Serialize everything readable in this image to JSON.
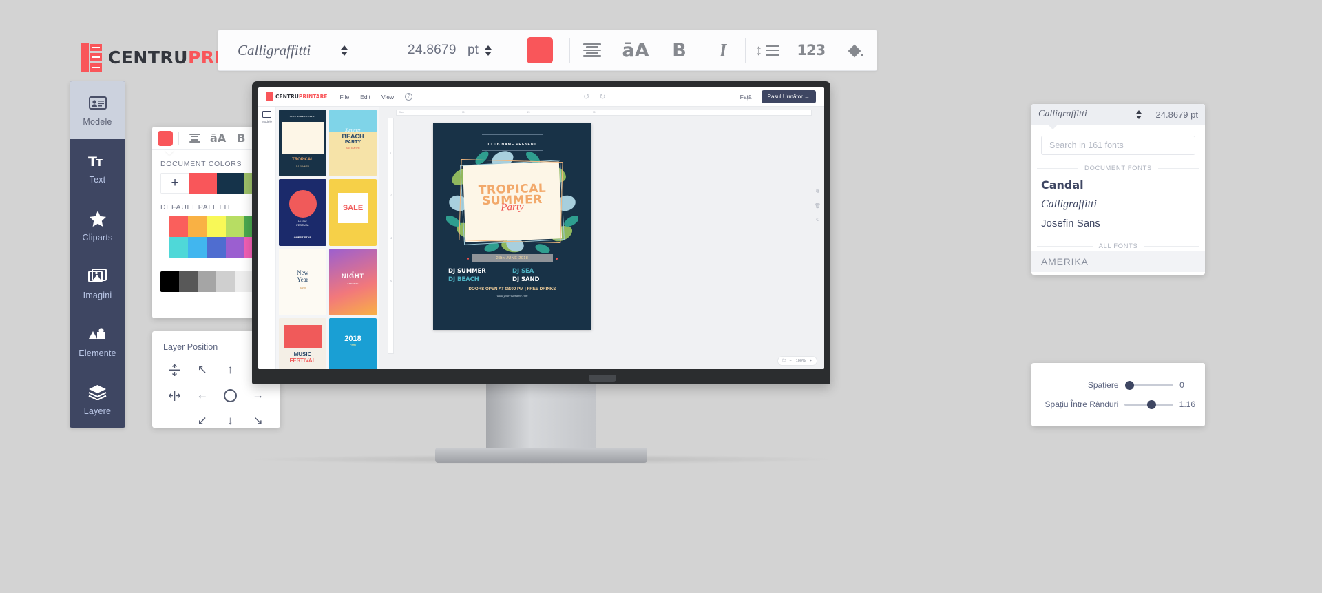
{
  "brand": {
    "name_part1": "CENTRU",
    "name_part2": "PRINTARE"
  },
  "toolbar": {
    "font_name": "Calligraffitti",
    "font_size": "24.8679",
    "font_size_unit": "pt",
    "color_swatch": "#f9565a",
    "icons": [
      {
        "name": "align-center-icon",
        "label": ""
      },
      {
        "name": "text-case-icon",
        "label": "āA"
      },
      {
        "name": "bold-icon",
        "label": "B"
      },
      {
        "name": "italic-icon",
        "label": "I"
      },
      {
        "name": "line-spacing-icon",
        "label": ""
      },
      {
        "name": "numbers-icon",
        "label": "123"
      },
      {
        "name": "fill-color-icon",
        "label": ""
      }
    ]
  },
  "sidebar": {
    "items": [
      {
        "label": "Modele",
        "icon": "id-card-icon",
        "active": true
      },
      {
        "label": "Text",
        "icon": "text-icon",
        "active": false
      },
      {
        "label": "Cliparts",
        "icon": "star-icon",
        "active": false
      },
      {
        "label": "Imagini",
        "icon": "image-icon",
        "active": false
      },
      {
        "label": "Elemente",
        "icon": "shapes-icon",
        "active": false
      },
      {
        "label": "Layere",
        "icon": "layers-icon",
        "active": false
      }
    ]
  },
  "color_panel": {
    "swatch": "#f9565a",
    "document_colors_title": "DOCUMENT COLORS",
    "add_label": "+",
    "document_colors": [
      "#f9565a",
      "#15334a",
      "#9dc069"
    ],
    "default_palette_title": "DEFAULT PALETTE",
    "default_palette": [
      [
        "#fa5f5c",
        "#f9b144",
        "#f8f857",
        "#b7dd63",
        "#4aa84f"
      ],
      [
        "#4fd8d8",
        "#41b6ef",
        "#4f6dd0",
        "#9b5fd0",
        "#f25fb4"
      ],
      [
        "#000000",
        "#585858",
        "#a5a5a5",
        "#cfcfcf",
        "#ededed",
        "#ffffff"
      ]
    ]
  },
  "layer_panel": {
    "title": "Layer Position",
    "close_label": "✕",
    "buttons": [
      {
        "name": "align-vertical-center",
        "glyph": "↕"
      },
      {
        "name": "move-up-left",
        "glyph": "↖"
      },
      {
        "name": "move-up",
        "glyph": "↑"
      },
      {
        "name": "move-up-right",
        "glyph": "↗"
      },
      {
        "name": "align-horizontal-center",
        "glyph": "↔"
      },
      {
        "name": "move-left",
        "glyph": "←"
      },
      {
        "name": "center",
        "glyph": "○"
      },
      {
        "name": "move-right",
        "glyph": "→"
      },
      {
        "name": "move-down-left",
        "glyph": "↙"
      },
      {
        "name": "move-down",
        "glyph": "↓"
      },
      {
        "name": "move-down-right",
        "glyph": "↘"
      }
    ]
  },
  "editor": {
    "menu": [
      "File",
      "Edit",
      "View"
    ],
    "help_label": "?",
    "face_label": "Față",
    "next_step_label": "Pasul Următor →",
    "rail_label": "Modele",
    "zoom_value": "100%",
    "zoom_minus": "−",
    "zoom_plus": "+",
    "templates": [
      {
        "name": "tropical-summer",
        "bg": "#183247"
      },
      {
        "name": "summer-beach-party",
        "bg": "#f2c94c"
      },
      {
        "name": "music-festival",
        "bg": "#1b2a6b"
      },
      {
        "name": "sale-flyer",
        "bg": "#f6d048"
      },
      {
        "name": "new-year-party",
        "bg": "#fdfaf3"
      },
      {
        "name": "night-party",
        "bg": "#5b3fa8"
      },
      {
        "name": "music-festival-2",
        "bg": "#f4efe6"
      },
      {
        "name": "your-club-2018",
        "bg": "#1a9fd4"
      }
    ]
  },
  "flyer": {
    "club_present": "CLUB NAME PRESENT",
    "title_line1": "TROPICAL",
    "title_line2": "SUMMER",
    "title_script": "Party",
    "date": "23th JUNE 2018",
    "djs": [
      "DJ SUMMER",
      "DJ SEA",
      "DJ BEACH",
      "DJ SAND"
    ],
    "dj_colors": [
      "#ffffff",
      "#4fb3c4",
      "#4fb3c4",
      "#ffffff"
    ],
    "doors": "DOORS OPEN AT 08:00 PM | FREE DRINKS",
    "url": "www.yourclubname.com"
  },
  "font_panel": {
    "selected_font": "Calligraffitti",
    "font_size": "24.8679",
    "font_size_unit": "pt",
    "search_placeholder": "Search in 161 fonts",
    "document_fonts_title": "DOCUMENT FONTS",
    "document_fonts": [
      "Candal",
      "Calligraffitti",
      "Josefin Sans"
    ],
    "all_fonts_title": "ALL FONTS",
    "all_fonts": [
      "AMERIKA"
    ]
  },
  "spacing_panel": {
    "rows": [
      {
        "label": "Spațiere",
        "value": "0",
        "knob_pct": 2
      },
      {
        "label": "Spațiu Între Rânduri",
        "value": "1.16",
        "knob_pct": 48
      }
    ]
  }
}
